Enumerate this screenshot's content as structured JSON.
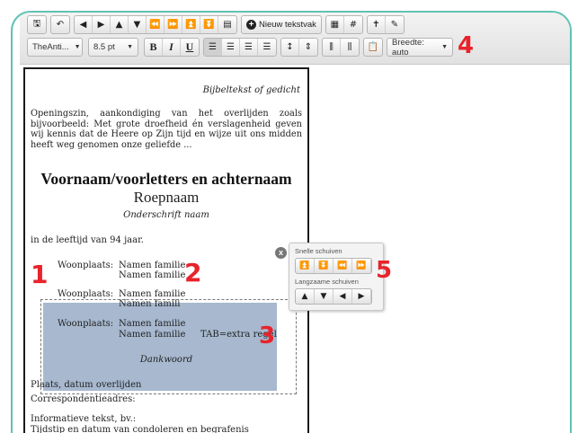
{
  "toolbar": {
    "row1": {
      "group1": [
        {
          "icon": "save-icon",
          "glyph": "🖫"
        }
      ],
      "group2": [
        {
          "icon": "undo-icon",
          "glyph": "↶"
        }
      ],
      "group3": [
        {
          "icon": "arrow-left-icon",
          "glyph": "◀"
        },
        {
          "icon": "arrow-right-icon",
          "glyph": "▶"
        },
        {
          "icon": "arrow-up-icon",
          "glyph": "▲"
        },
        {
          "icon": "arrow-down-icon",
          "glyph": "▼"
        },
        {
          "icon": "fast-left-icon",
          "glyph": "⏪"
        },
        {
          "icon": "fast-right-icon",
          "glyph": "⏩"
        },
        {
          "icon": "move-top-icon",
          "glyph": "⏫"
        },
        {
          "icon": "move-bottom-icon",
          "glyph": "⏬"
        },
        {
          "icon": "layout-icon",
          "glyph": "▤"
        }
      ],
      "new_textbox_label": "Nieuw tekstvak",
      "group5": [
        {
          "icon": "grid-icon",
          "glyph": "▦"
        },
        {
          "icon": "hash-icon",
          "glyph": "#"
        }
      ],
      "group6": [
        {
          "icon": "cross-icon",
          "glyph": "✝"
        },
        {
          "icon": "wand-icon",
          "glyph": "✎"
        }
      ]
    },
    "row2": {
      "font_family": "TheAnti...",
      "font_size": "8.5 pt",
      "bold": "B",
      "italic": "I",
      "underline": "U",
      "align_group": [
        {
          "icon": "align-left-icon",
          "glyph": "☰"
        },
        {
          "icon": "align-center-icon",
          "glyph": "☰"
        },
        {
          "icon": "align-right-icon",
          "glyph": "☰"
        },
        {
          "icon": "align-justify-icon",
          "glyph": "☰"
        }
      ],
      "spacing_group": [
        {
          "icon": "line-spacing-icon",
          "glyph": "↕"
        },
        {
          "icon": "paragraph-spacing-icon",
          "glyph": "⇕"
        }
      ],
      "column_group": [
        {
          "icon": "column-left-icon",
          "glyph": "⫼"
        },
        {
          "icon": "column-right-icon",
          "glyph": "⫼"
        }
      ],
      "paste_icon": "📋",
      "width_label": "Breedte: auto"
    }
  },
  "document": {
    "bible_text": "Bijbeltekst of gedicht",
    "opening": "Openingszin, aankondiging van het overlijden zoals bijvoorbeeld: Met grote droefheid én verslagenheid geven wij kennis dat de Heere op Zijn tijd en wijze uit ons midden heeft weg genomen onze geliefde ...",
    "name_heading": "Voornaam/voorletters en achternaam",
    "roepnaam": "Roepnaam",
    "subscript": "Onderschrift naam",
    "age": "in de leeftijd van 94 jaar.",
    "residence_rows": [
      {
        "label": "Woonplaats:",
        "line1": "Namen familie",
        "line2": "Namen familie"
      },
      {
        "label": "Woonplaats:",
        "line1": "Namen familie",
        "line2": "Namen famili"
      },
      {
        "label": "Woonplaats:",
        "line1": "Namen familie",
        "line2": "Namen familie"
      }
    ],
    "tab_note": "TAB=extra regel",
    "thanks": "Dankwoord",
    "place_date": "Plaats, datum overlijden",
    "correspondence": "Correspondentieadres:",
    "info": "Informatieve tekst, bv.:",
    "condolence": "Tijdstip en datum van condoleren en begrafenis"
  },
  "popup": {
    "fast_label": "Snelle schuiven",
    "fast_buttons": [
      {
        "icon": "move-top-icon",
        "glyph": "⏫"
      },
      {
        "icon": "move-bottom-icon",
        "glyph": "⏬"
      },
      {
        "icon": "fast-left-icon",
        "glyph": "⏪"
      },
      {
        "icon": "fast-right-icon",
        "glyph": "⏩"
      }
    ],
    "slow_label": "Langzaame schuiven",
    "slow_buttons": [
      {
        "icon": "arrow-up-icon",
        "glyph": "▲"
      },
      {
        "icon": "arrow-down-icon",
        "glyph": "▼"
      },
      {
        "icon": "arrow-left-icon",
        "glyph": "◀"
      },
      {
        "icon": "arrow-right-icon",
        "glyph": "▶"
      }
    ]
  },
  "close_glyph": "x",
  "annotations": {
    "n1": "1",
    "n2": "2",
    "n3": "3",
    "n4": "4",
    "n5": "5"
  },
  "colors": {
    "accent_frame": "#5fc2b3",
    "annotation_red": "#e8232b",
    "selection": "#a7b8cf"
  }
}
